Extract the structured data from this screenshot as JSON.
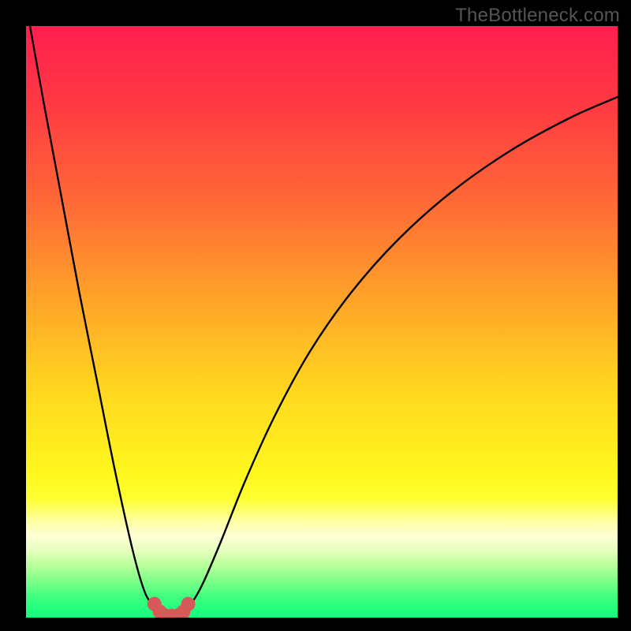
{
  "watermark": {
    "text": "TheBottleneck.com"
  },
  "chart_data": {
    "type": "line",
    "title": "",
    "xlabel": "",
    "ylabel": "",
    "xlim": [
      0,
      100
    ],
    "ylim": [
      0,
      100
    ],
    "grid": false,
    "legend": false,
    "series": [
      {
        "name": "curve-left",
        "x": [
          0.67,
          3,
          6,
          9,
          12,
          15,
          18,
          20,
          21.5,
          22.5
        ],
        "values": [
          100,
          87,
          71,
          55,
          40,
          25,
          11.5,
          4.5,
          2.1,
          1.6
        ]
      },
      {
        "name": "curve-right",
        "x": [
          26.6,
          28,
          30,
          33,
          37,
          42,
          48,
          55,
          63,
          72,
          82,
          92,
          100
        ],
        "values": [
          1.6,
          2.5,
          6,
          13,
          23,
          34,
          45,
          55,
          64,
          72,
          79,
          84.5,
          88
        ]
      },
      {
        "name": "valley-dots",
        "x": [
          21.7,
          22.6,
          23.4,
          24.6,
          25.8,
          26.6,
          27.4
        ],
        "values": [
          2.3,
          1.0,
          0.4,
          0.3,
          0.4,
          1.0,
          2.3
        ]
      }
    ],
    "background_gradient": {
      "type": "vertical",
      "stops": [
        {
          "pos": 0.0,
          "color": "#ff1f4f"
        },
        {
          "pos": 0.14,
          "color": "#ff3b42"
        },
        {
          "pos": 0.3,
          "color": "#ff6a36"
        },
        {
          "pos": 0.46,
          "color": "#ffa329"
        },
        {
          "pos": 0.62,
          "color": "#ffd81f"
        },
        {
          "pos": 0.76,
          "color": "#fff81e"
        },
        {
          "pos": 0.8,
          "color": "#ffff33"
        },
        {
          "pos": 0.835,
          "color": "#ffffa0"
        },
        {
          "pos": 0.862,
          "color": "#feffd5"
        },
        {
          "pos": 0.888,
          "color": "#e4ffbb"
        },
        {
          "pos": 0.912,
          "color": "#b7ff9a"
        },
        {
          "pos": 0.938,
          "color": "#7dff87"
        },
        {
          "pos": 0.965,
          "color": "#3eff7e"
        },
        {
          "pos": 1.0,
          "color": "#0fff7c"
        }
      ]
    },
    "valley_marker_color": "#d65a5a",
    "curve_color": "#000000"
  }
}
